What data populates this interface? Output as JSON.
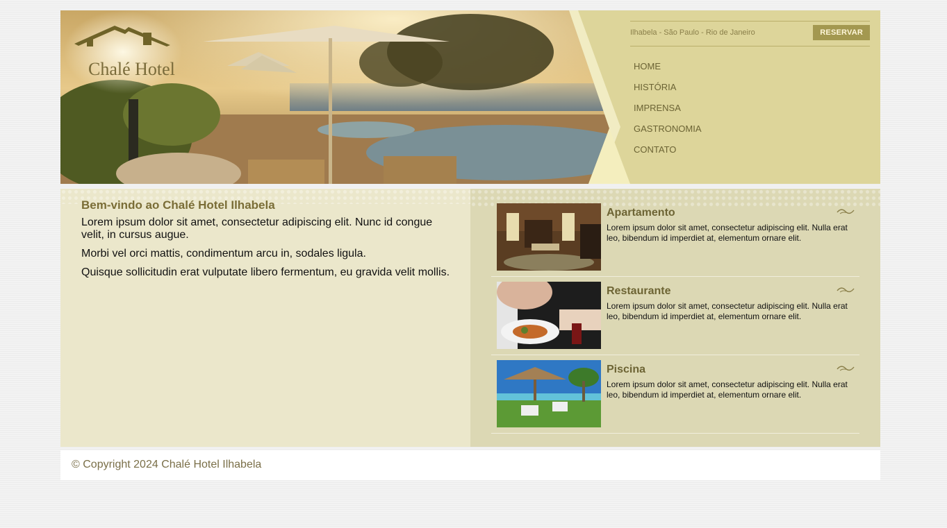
{
  "brand": {
    "name": "Chalé Hotel"
  },
  "topbar": {
    "locations": "Ilhabela - São Paulo - Rio de Janeiro",
    "reserve_label": "RESERVAR"
  },
  "nav": {
    "items": [
      "HOME",
      "HISTÓRIA",
      "IMPRENSA",
      "GASTRONOMIA",
      "CONTATO"
    ]
  },
  "welcome": {
    "title": "Bem-vindo ao Chalé Hotel Ilhabela",
    "paragraphs": [
      "Lorem ipsum dolor sit amet, consectetur adipiscing elit. Nunc id congue velit, in cursus augue.",
      "Morbi vel orci mattis, condimentum arcu in, sodales ligula.",
      "Quisque sollicitudin erat vulputate libero fermentum, eu gravida velit mollis."
    ]
  },
  "features": [
    {
      "title": "Apartamento",
      "text": "Lorem ipsum dolor sit amet, consectetur adipiscing elit. Nulla erat leo, bibendum id imperdiet at, elementum ornare elit."
    },
    {
      "title": "Restaurante",
      "text": "Lorem ipsum dolor sit amet, consectetur adipiscing elit. Nulla erat leo, bibendum id imperdiet at, elementum ornare elit."
    },
    {
      "title": "Piscina",
      "text": "Lorem ipsum dolor sit amet, consectetur adipiscing elit. Nulla erat leo, bibendum id imperdiet at, elementum ornare elit."
    }
  ],
  "footer": {
    "copyright": "© Copyright 2024 Chalé Hotel Ilhabela"
  },
  "colors": {
    "accent": "#a39850",
    "header_bg": "#ddd59a",
    "content_bg": "#ebe7cb",
    "sidebar_bg": "#dcd8b4",
    "title": "#7a6d36"
  }
}
